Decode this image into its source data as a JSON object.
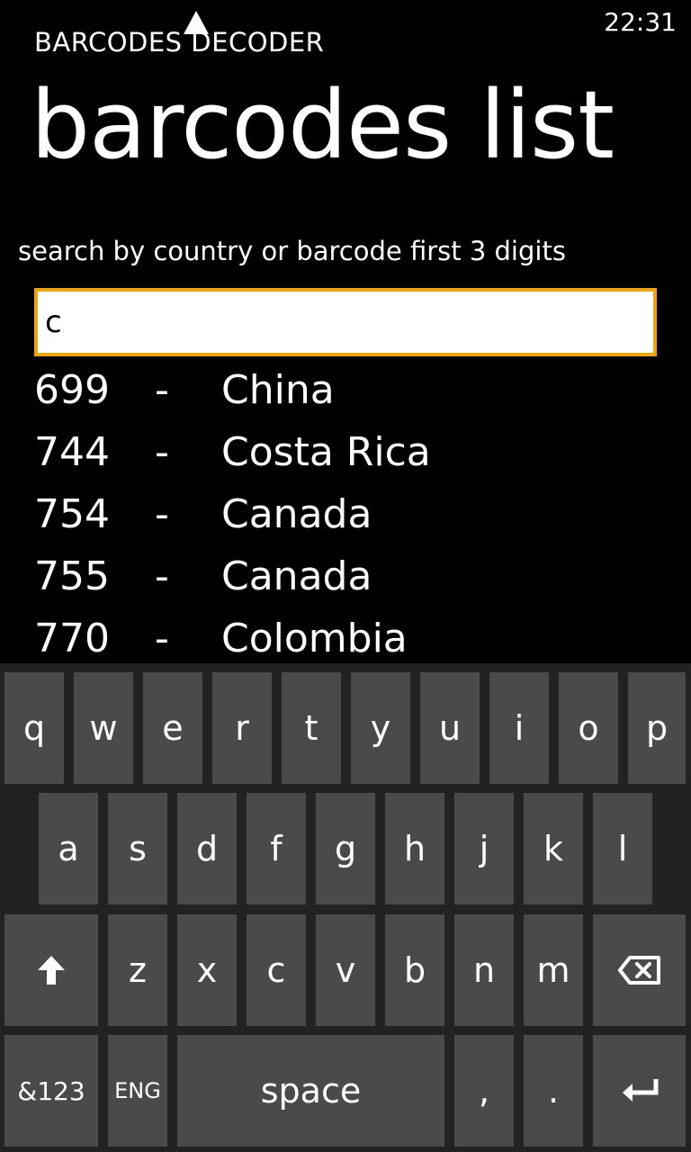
{
  "status_bar": {
    "time": "22:31"
  },
  "app_title": "BARCODES DECODER",
  "page_title": "barcodes list",
  "search": {
    "label": "search by country or barcode first 3 digits",
    "value": "c",
    "accent_color": "#f0a30a"
  },
  "results": [
    {
      "code": "699",
      "sep": "-",
      "country": "China"
    },
    {
      "code": "744",
      "sep": "-",
      "country": "Costa Rica"
    },
    {
      "code": "754",
      "sep": "-",
      "country": "Canada"
    },
    {
      "code": "755",
      "sep": "-",
      "country": "Canada"
    },
    {
      "code": "770",
      "sep": "-",
      "country": "Colombia"
    }
  ],
  "keyboard": {
    "row1": [
      "q",
      "w",
      "e",
      "r",
      "t",
      "y",
      "u",
      "i",
      "o",
      "p"
    ],
    "row2": [
      "a",
      "s",
      "d",
      "f",
      "g",
      "h",
      "j",
      "k",
      "l"
    ],
    "row3": [
      "z",
      "x",
      "c",
      "v",
      "b",
      "n",
      "m"
    ],
    "row4": {
      "symbols": "&123",
      "lang": "ENG",
      "space": "space",
      "comma": ",",
      "period": "."
    },
    "shift_icon": "up-arrow-icon",
    "backspace_icon": "backspace-icon",
    "enter_icon": "enter-icon"
  }
}
